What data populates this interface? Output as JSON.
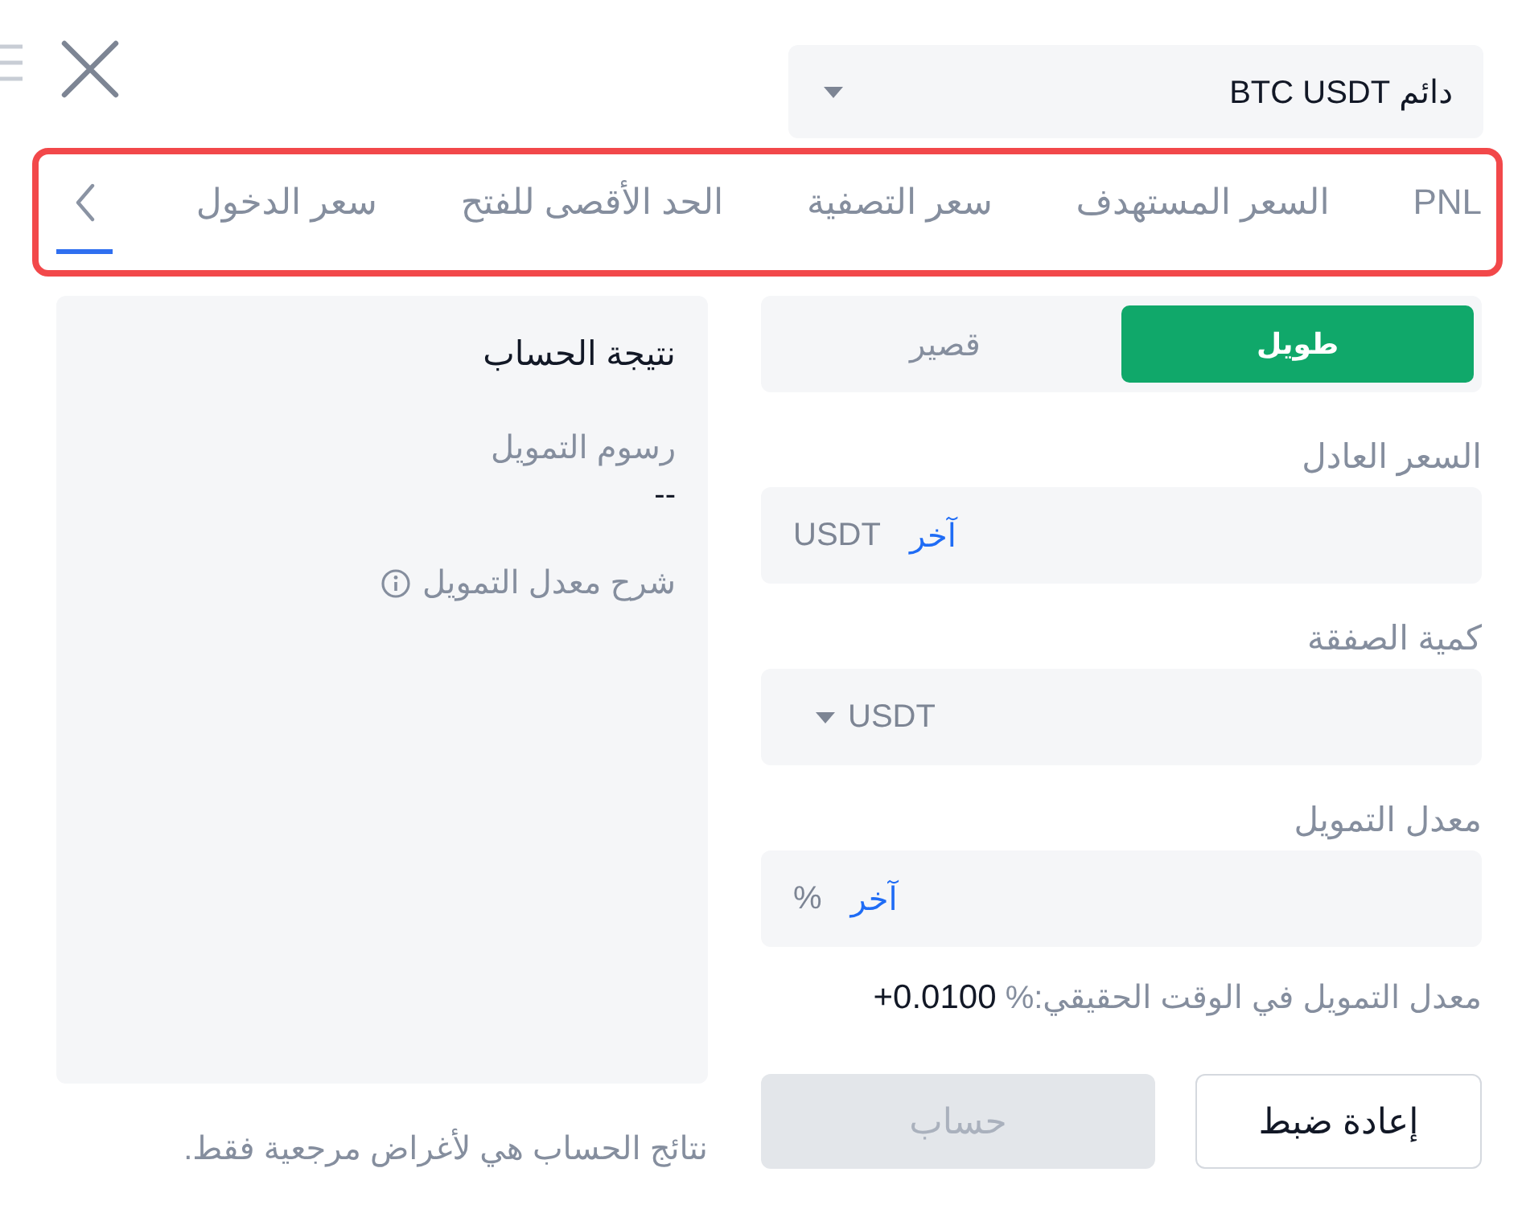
{
  "header": {
    "contract_select": {
      "value": "دائم BTC USDT"
    }
  },
  "tabs": {
    "highlighted": true,
    "items": [
      {
        "kind": "text",
        "label": "PNL",
        "selected": false
      },
      {
        "kind": "text",
        "label": "السعر المستهدف",
        "selected": false
      },
      {
        "kind": "text",
        "label": "سعر التصفية",
        "selected": false
      },
      {
        "kind": "text",
        "label": "الحد الأقصى للفتح",
        "selected": false
      },
      {
        "kind": "text",
        "label": "سعر الدخول",
        "selected": false
      },
      {
        "kind": "overflow",
        "selected": true
      }
    ]
  },
  "side_toggle": [
    {
      "label": "طويل",
      "selected": true
    },
    {
      "label": "قصير",
      "selected": false
    }
  ],
  "fields": [
    {
      "kind": "input",
      "label": "السعر العادل",
      "quick_fill": "آخر",
      "unit": "USDT"
    },
    {
      "kind": "select",
      "label": "كمية الصفقة",
      "unit": "USDT"
    },
    {
      "kind": "input",
      "label": "معدل التمويل",
      "quick_fill": "آخر",
      "unit": "%"
    }
  ],
  "realtime_rate": {
    "label": "معدل التمويل في الوقت الحقيقي:%",
    "value": "+0.0100"
  },
  "buttons": [
    {
      "kind": "reset",
      "label": "إعادة ضبط",
      "disabled": false
    },
    {
      "kind": "calculate",
      "label": "حساب",
      "disabled": true
    }
  ],
  "result": {
    "title": "نتيجة الحساب",
    "items": [
      {
        "label": "رسوم التمويل",
        "value": "--"
      }
    ],
    "explain_link": "شرح معدل التمويل"
  },
  "disclaimer": "نتائج الحساب هي لأغراض مرجعية فقط."
}
